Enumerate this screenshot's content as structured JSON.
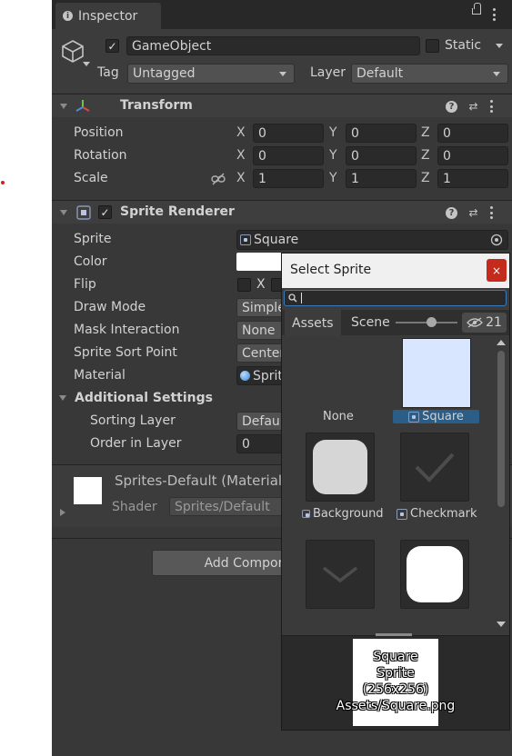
{
  "inspector": {
    "tab_label": "Inspector",
    "gameobject": {
      "active": true,
      "name": "GameObject",
      "static_label": "Static",
      "tag_label": "Tag",
      "tag_value": "Untagged",
      "layer_label": "Layer",
      "layer_value": "Default"
    },
    "transform": {
      "title": "Transform",
      "rows": [
        {
          "label": "Position",
          "x": "0",
          "y": "0",
          "z": "0"
        },
        {
          "label": "Rotation",
          "x": "0",
          "y": "0",
          "z": "0"
        },
        {
          "label": "Scale",
          "x": "1",
          "y": "1",
          "z": "1"
        }
      ],
      "axis_x": "X",
      "axis_y": "Y",
      "axis_z": "Z"
    },
    "sprite_renderer": {
      "title": "Sprite Renderer",
      "enabled": true,
      "sprite_label": "Sprite",
      "sprite_value": "Square",
      "color_label": "Color",
      "flip_label": "Flip",
      "flip_x": "X",
      "draw_mode_label": "Draw Mode",
      "draw_mode_value": "Simple",
      "mask_label": "Mask Interaction",
      "mask_value": "None",
      "sort_point_label": "Sprite Sort Point",
      "sort_point_value": "Center",
      "material_label": "Material",
      "material_value": "Sprites-Default",
      "additional_settings": "Additional Settings",
      "sorting_layer_label": "Sorting Layer",
      "sorting_layer_value": "Default",
      "order_label": "Order in Layer",
      "order_value": "0"
    },
    "material": {
      "name": "Sprites-Default (Material)",
      "shader_label": "Shader",
      "shader_value": "Sprites/Default"
    },
    "add_component": "Add Component"
  },
  "select_sprite": {
    "title": "Select Sprite",
    "close_glyph": "×",
    "search_value": "",
    "tabs": [
      "Assets",
      "Scene"
    ],
    "hidden_count": "21",
    "items": [
      {
        "label": "None",
        "selected": false
      },
      {
        "label": "Square",
        "selected": true
      },
      {
        "label": "Background",
        "selected": false
      },
      {
        "label": "Checkmark",
        "selected": false
      }
    ],
    "preview_line1": "Square",
    "preview_line2": "Sprite",
    "preview_line3": "(256x256)",
    "preview_line4": "Assets/Square.png"
  },
  "colors": {
    "panel_bg": "#383838",
    "selection": "#2c5d87",
    "close_red": "#c42b1c",
    "search_focus": "#3a79bb"
  }
}
